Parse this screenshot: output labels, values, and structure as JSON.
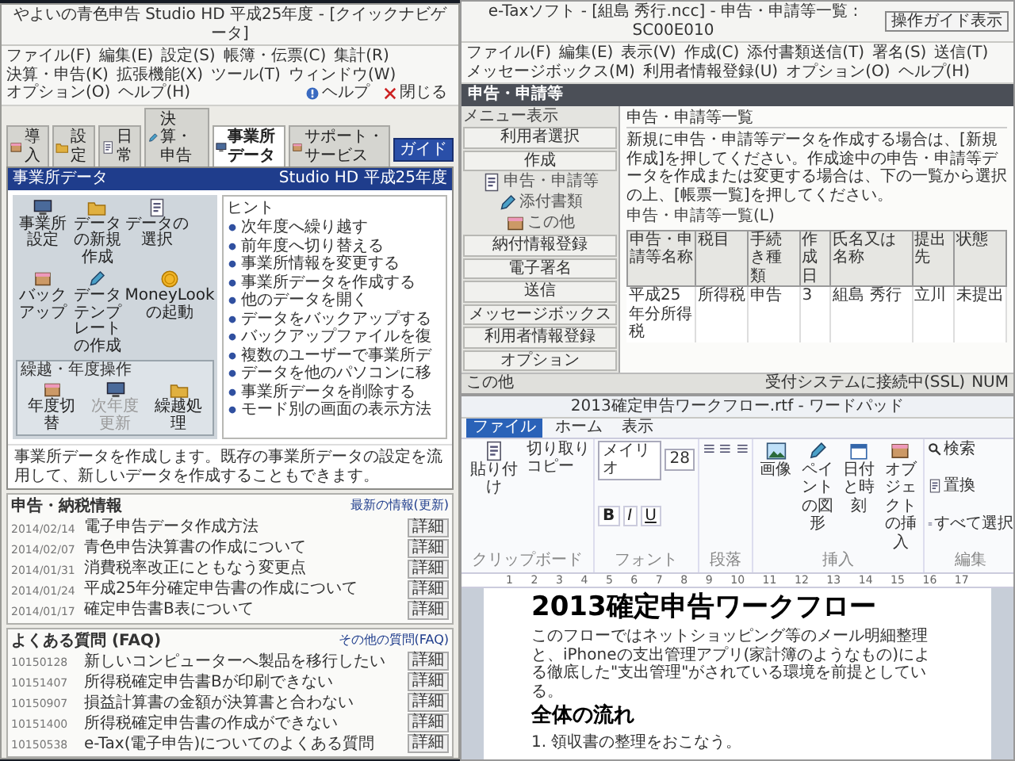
{
  "yayoi": {
    "title": "やよいの青色申告 Studio HD 平成25年度 - [クイックナビゲータ]",
    "menu": [
      "ファイル(F)",
      "編集(E)",
      "設定(S)",
      "帳簿・伝票(C)",
      "集計(R)",
      "決算・申告(K)",
      "拡張機能(X)",
      "ツール(T)",
      "ウィンドウ(W)",
      "オプション(O)",
      "ヘルプ(H)"
    ],
    "toolbar": [
      "ヘルプ",
      "閉じる"
    ],
    "categories": [
      {
        "label": "導入",
        "selected": false
      },
      {
        "label": "設定",
        "selected": false
      },
      {
        "label": "日常",
        "selected": false
      },
      {
        "label": "決算・申告",
        "selected": false
      },
      {
        "label": "事業所データ",
        "selected": true
      },
      {
        "label": "サポート・サービス",
        "selected": false
      }
    ],
    "guide_button": "ガイド",
    "panel": {
      "title": "事業所データ",
      "edition": "Studio HD 平成25年度",
      "tiles": [
        {
          "label": "事業所設定",
          "disabled": false
        },
        {
          "label": "データの新規作成",
          "disabled": false
        },
        {
          "label": "データの選択",
          "disabled": false
        },
        {
          "label": "バックアップ",
          "disabled": false
        },
        {
          "label": "データテンプレートの作成",
          "disabled": false
        },
        {
          "label": "MoneyLookの起動",
          "disabled": false
        }
      ],
      "group": {
        "title": "繰越・年度操作",
        "tiles": [
          {
            "label": "年度切替",
            "disabled": false
          },
          {
            "label": "次年度更新",
            "disabled": true
          },
          {
            "label": "繰越処理",
            "disabled": false
          }
        ]
      },
      "hint_title": "ヒント",
      "hints": [
        "次年度へ繰り越す",
        "前年度へ切り替える",
        "事業所情報を変更する",
        "事業所データを作成する",
        "他のデータを開く",
        "データをバックアップする",
        "バックアップファイルを復",
        "複数のユーザーで事業所デ",
        "データを他のパソコンに移",
        "事業所データを削除する",
        "モード別の画面の表示方法"
      ],
      "description": "事業所データを作成します。既存の事業所データの設定を流用して、新しいデータを作成することもできます。"
    },
    "news": [
      {
        "title": "申告・納税情報",
        "link": "最新の情報(更新)",
        "rows": [
          {
            "date": "2014/02/14",
            "text": "電子申告データ作成方法",
            "action": "詳細"
          },
          {
            "date": "2014/02/07",
            "text": "青色申告決算書の作成について",
            "action": "詳細"
          },
          {
            "date": "2014/01/31",
            "text": "消費税率改正にともなう変更点",
            "action": "詳細"
          },
          {
            "date": "2014/01/24",
            "text": "平成25年分確定申告書の作成について",
            "action": "詳細"
          },
          {
            "date": "2014/01/17",
            "text": "確定申告書B表について",
            "action": "詳細"
          }
        ]
      },
      {
        "title": "よくある質問 (FAQ)",
        "link": "その他の質問(FAQ)",
        "rows": [
          {
            "date": "10150128",
            "text": "新しいコンピューターへ製品を移行したい",
            "action": "詳細"
          },
          {
            "date": "10151407",
            "text": "所得税確定申告書Bが印刷できない",
            "action": "詳細"
          },
          {
            "date": "10150907",
            "text": "損益計算書の金額が決算書と合わない",
            "action": "詳細"
          },
          {
            "date": "10151400",
            "text": "所得税確定申告書の作成ができない",
            "action": "詳細"
          },
          {
            "date": "10150538",
            "text": "e-Tax(電子申告)についてのよくある質問",
            "action": "詳細"
          }
        ]
      }
    ]
  },
  "etax": {
    "title": "e-Taxソフト - [組島 秀行.ncc] - 申告・申請等一覧 : SC00E010",
    "menu": [
      "ファイル(F)",
      "編集(E)",
      "表示(V)",
      "作成(C)",
      "添付書類送信(T)",
      "署名(S)",
      "送信(T)",
      "メッセージボックス(M)",
      "利用者情報登録(U)",
      "オプション(O)",
      "ヘルプ(H)"
    ],
    "guide_button": "操作ガイド表示",
    "section": "申告・申請等",
    "sidebar": {
      "label": "メニュー表示",
      "top_buttons": [
        "利用者選択",
        "作成"
      ],
      "icons": [
        "申告・申請等",
        "添付書類",
        "この他"
      ],
      "bottom_buttons": [
        "納付情報登録",
        "電子署名",
        "送信",
        "メッセージボックス",
        "利用者情報登録",
        "オプション"
      ]
    },
    "heading": "申告・申請等一覧",
    "instruction": "新規に申告・申請等データを作成する場合は、[新規作成]を押してください。作成途中の申告・申請等データを作成または変更する場合は、下の一覧から選択の上、[帳票一覧]を押してください。",
    "list_label": "申告・申請等一覧(L)",
    "columns": [
      "申告・申請等名称",
      "税目",
      "手続き種類",
      "作成日",
      "氏名又は名称",
      "提出先",
      "状態"
    ],
    "rows": [
      [
        "平成25年分所得税",
        "所得税",
        "申告",
        "3",
        "組島 秀行",
        "立川",
        "未提出"
      ]
    ],
    "status_bar": {
      "left": "この他",
      "connection": "受付システムに接続中(SSL)",
      "num": "NUM"
    }
  },
  "wordpad": {
    "title": "2013確定申告ワークフロー.rtf - ワードパッド",
    "tabs": [
      {
        "label": "ファイル",
        "selected": true
      },
      {
        "label": "ホーム",
        "selected": false
      },
      {
        "label": "表示",
        "selected": false
      }
    ],
    "clipboard": {
      "paste": "貼り付け",
      "cut": "切り取り",
      "copy": "コピー",
      "label": "クリップボード"
    },
    "font": {
      "name": "メイリオ",
      "size": "28",
      "styles": [
        "B",
        "I",
        "U"
      ],
      "label": "フォント"
    },
    "paragraph_label": "段落",
    "insert": {
      "buttons": [
        "画像",
        "ペイントの図形",
        "日付と時刻",
        "オブジェクトの挿入"
      ],
      "label": "挿入"
    },
    "edit": {
      "buttons": [
        "検索",
        "置換",
        "すべて選択"
      ],
      "label": "編集"
    },
    "ruler": [
      "1",
      "2",
      "3",
      "4",
      "5",
      "6",
      "7",
      "8",
      "9",
      "10",
      "11",
      "12",
      "13",
      "14",
      "15",
      "16",
      "17"
    ],
    "document": {
      "heading": "2013確定申告ワークフロー",
      "paragraph": "このフローではネットショッピング等のメール明細整理と、iPhoneの支出管理アプリ(家計簿のようなもの)による徹底した\"支出管理\"がされている環境を前提としている。",
      "subheading": "全体の流れ",
      "item": "1. 領収書の整理をおこなう。"
    }
  }
}
